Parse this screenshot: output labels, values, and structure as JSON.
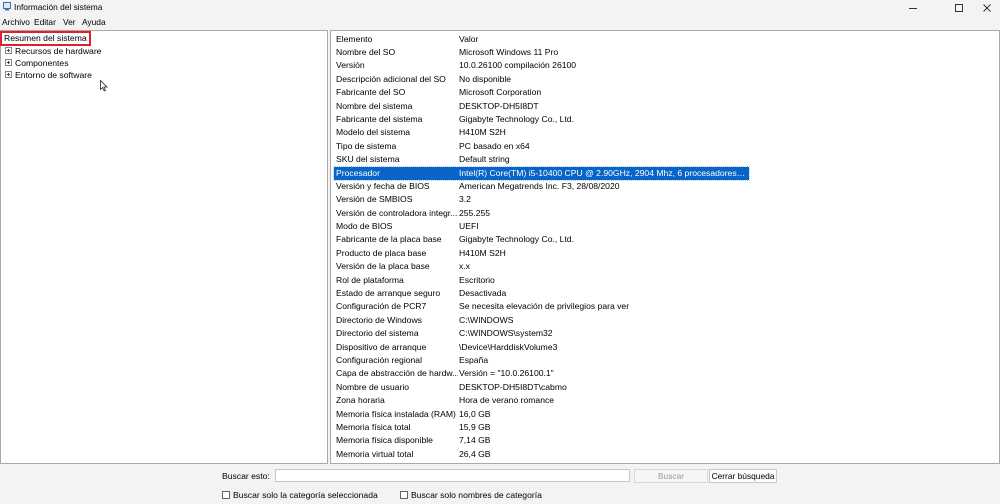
{
  "window": {
    "title": "Información del sistema"
  },
  "menu": {
    "items": [
      "Archivo",
      "Editar",
      "Ver",
      "Ayuda"
    ]
  },
  "tree": {
    "root": "Resumen del sistema",
    "nodes": [
      "Recursos de hardware",
      "Componentes",
      "Entorno de software"
    ]
  },
  "list": {
    "headers": [
      "Elemento",
      "Valor"
    ],
    "selected_index": 10,
    "rows": [
      [
        "Nombre del SO",
        "Microsoft Windows 11 Pro"
      ],
      [
        "Versión",
        "10.0.26100 compilación 26100"
      ],
      [
        "Descripción adicional del SO",
        "No disponible"
      ],
      [
        "Fabricante del SO",
        "Microsoft Corporation"
      ],
      [
        "Nombre del sistema",
        "DESKTOP-DH5I8DT"
      ],
      [
        "Fabricante del sistema",
        "Gigabyte Technology Co., Ltd."
      ],
      [
        "Modelo del sistema",
        "H410M S2H"
      ],
      [
        "Tipo de sistema",
        "PC basado en x64"
      ],
      [
        "SKU del sistema",
        "Default string"
      ],
      [
        "Procesador",
        "Intel(R) Core(TM) i5-10400 CPU @ 2.90GHz, 2904 Mhz, 6 procesadores princ..."
      ],
      [
        "Versión y fecha de BIOS",
        "American Megatrends Inc. F3, 28/08/2020"
      ],
      [
        "Versión de SMBIOS",
        "3.2"
      ],
      [
        "Versión de controladora integr...",
        "255.255"
      ],
      [
        "Modo de BIOS",
        "UEFI"
      ],
      [
        "Fabricante de la placa base",
        "Gigabyte Technology Co., Ltd."
      ],
      [
        "Producto de placa base",
        "H410M S2H"
      ],
      [
        "Versión de la placa base",
        "x.x"
      ],
      [
        "Rol de plataforma",
        "Escritorio"
      ],
      [
        "Estado de arranque seguro",
        "Desactivada"
      ],
      [
        "Configuración de PCR7",
        "Se necesita elevación de privilegios para ver"
      ],
      [
        "Directorio de Windows",
        "C:\\WINDOWS"
      ],
      [
        "Directorio del sistema",
        "C:\\WINDOWS\\system32"
      ],
      [
        "Dispositivo de arranque",
        "\\Device\\HarddiskVolume3"
      ],
      [
        "Configuración regional",
        "España"
      ],
      [
        "Capa de abstracción de hardw...",
        "Versión = \"10.0.26100.1\""
      ],
      [
        "Nombre de usuario",
        "DESKTOP-DH5I8DT\\cabmo"
      ],
      [
        "Zona horaria",
        "Hora de verano romance"
      ],
      [
        "Memoria física instalada (RAM)",
        "16,0 GB"
      ],
      [
        "Memoria física total",
        "15,9 GB"
      ],
      [
        "Memoria física disponible",
        "7,14 GB"
      ],
      [
        "Memoria virtual total",
        "26,4 GB"
      ]
    ]
  },
  "search": {
    "label": "Buscar esto:",
    "value": "",
    "search_button": "Buscar",
    "close_button": "Cerrar búsqueda",
    "check_selected_category": "Buscar solo la categoría seleccionada",
    "check_category_names": "Buscar solo nombres de categoría"
  },
  "colors": {
    "selection": "#0a64c8",
    "highlight_outline": "#e0202a"
  }
}
